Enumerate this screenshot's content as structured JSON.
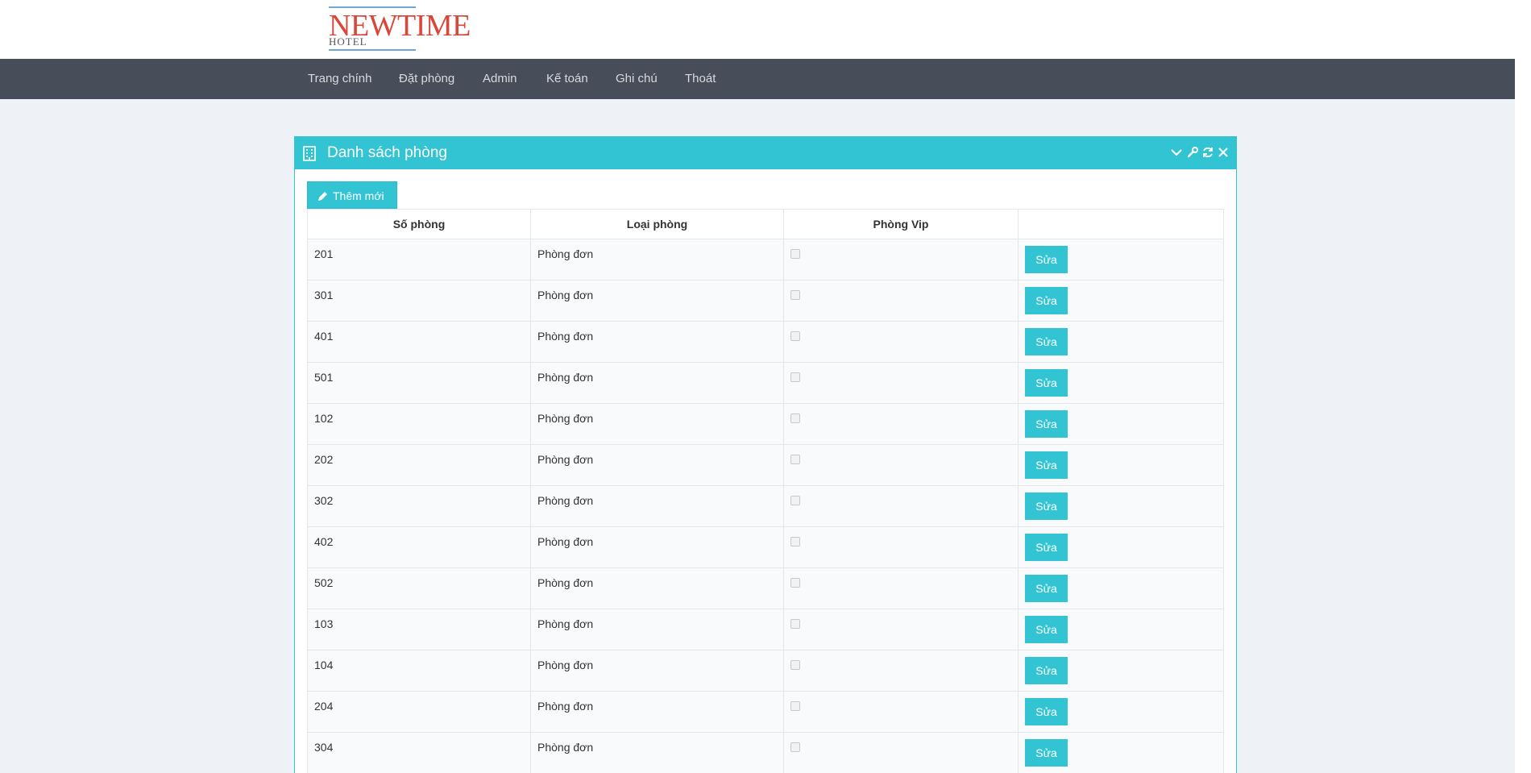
{
  "logo": {
    "brand": "NEWTIME",
    "sub": "HOTEL"
  },
  "nav": [
    {
      "label": "Trang chính"
    },
    {
      "label": "Đặt phòng"
    },
    {
      "label": "Admin"
    },
    {
      "label": "Kế toán"
    },
    {
      "label": "Ghi chú"
    },
    {
      "label": "Thoát"
    }
  ],
  "panel": {
    "title": "Danh sách phòng",
    "icon": "building-icon",
    "tools": [
      "chevron-down-icon",
      "wrench-icon",
      "refresh-icon",
      "close-icon"
    ]
  },
  "toolbar": {
    "add_label": "Thêm mới",
    "add_icon": "pencil-icon"
  },
  "table": {
    "headers": [
      "Số phòng",
      "Loại phòng",
      "Phòng Vip",
      ""
    ],
    "edit_label": "Sửa",
    "rows": [
      {
        "room": "201",
        "type": "Phòng đơn",
        "vip": false
      },
      {
        "room": "301",
        "type": "Phòng đơn",
        "vip": false
      },
      {
        "room": "401",
        "type": "Phòng đơn",
        "vip": false
      },
      {
        "room": "501",
        "type": "Phòng đơn",
        "vip": false
      },
      {
        "room": "102",
        "type": "Phòng đơn",
        "vip": false
      },
      {
        "room": "202",
        "type": "Phòng đơn",
        "vip": false
      },
      {
        "room": "302",
        "type": "Phòng đơn",
        "vip": false
      },
      {
        "room": "402",
        "type": "Phòng đơn",
        "vip": false
      },
      {
        "room": "502",
        "type": "Phòng đơn",
        "vip": false
      },
      {
        "room": "103",
        "type": "Phòng đơn",
        "vip": false
      },
      {
        "room": "104",
        "type": "Phòng đơn",
        "vip": false
      },
      {
        "room": "204",
        "type": "Phòng đơn",
        "vip": false
      },
      {
        "room": "304",
        "type": "Phòng đơn",
        "vip": false
      }
    ]
  },
  "colors": {
    "accent": "#33c4d4",
    "navbar": "#474e59",
    "brand": "#d9473a",
    "background": "#eef2f6"
  }
}
